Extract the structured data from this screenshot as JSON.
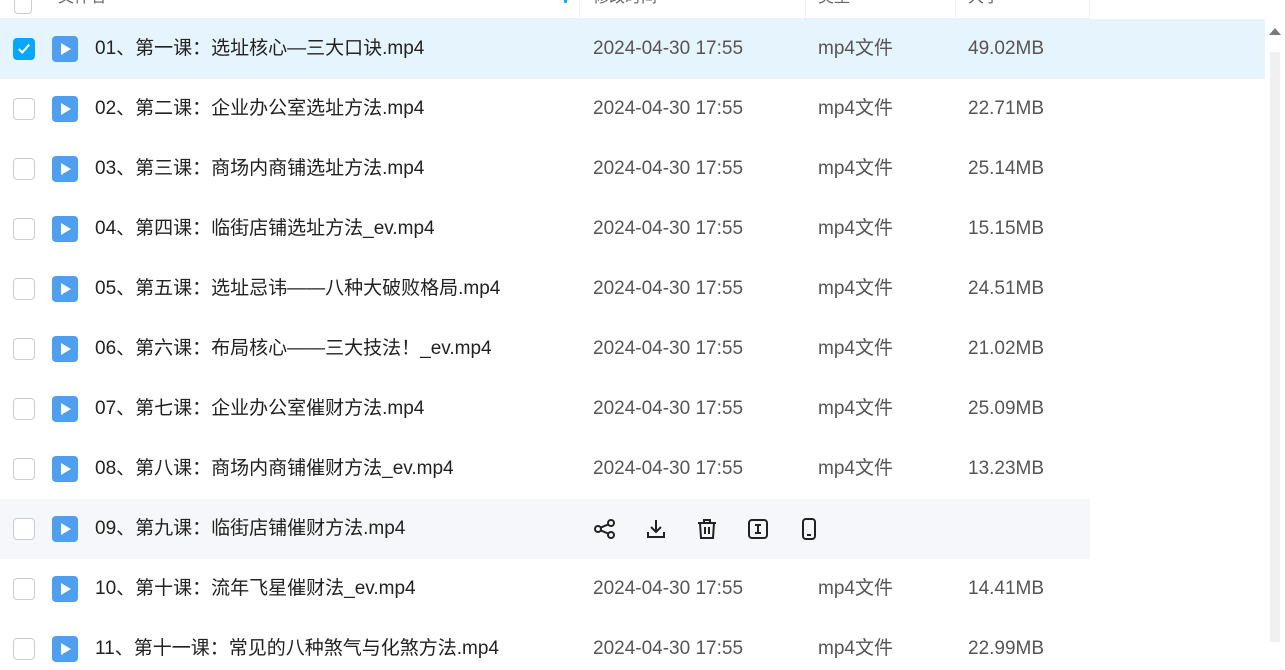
{
  "header": {
    "name_label": "文件名",
    "time_label": "修改时间",
    "type_label": "类型",
    "size_label": "大小"
  },
  "actions": {
    "icons": [
      "share-icon",
      "download-icon",
      "delete-icon",
      "rename-icon",
      "mobile-icon"
    ]
  },
  "colors": {
    "accent": "#06a7ff",
    "selected_row": "#e6f4fd",
    "hover_row": "#f6f7fa",
    "file_icon": "#4e9fef"
  },
  "files": [
    {
      "name": "01、第一课：选址核心—三大口诀.mp4",
      "time": "2024-04-30 17:55",
      "type": "mp4文件",
      "size": "49.02MB"
    },
    {
      "name": "02、第二课：企业办公室选址方法.mp4",
      "time": "2024-04-30 17:55",
      "type": "mp4文件",
      "size": "22.71MB"
    },
    {
      "name": "03、第三课：商场内商铺选址方法.mp4",
      "time": "2024-04-30 17:55",
      "type": "mp4文件",
      "size": "25.14MB"
    },
    {
      "name": "04、第四课：临街店铺选址方法_ev.mp4",
      "time": "2024-04-30 17:55",
      "type": "mp4文件",
      "size": "15.15MB"
    },
    {
      "name": "05、第五课：选址忌讳——八种大破败格局.mp4",
      "time": "2024-04-30 17:55",
      "type": "mp4文件",
      "size": "24.51MB"
    },
    {
      "name": "06、第六课：布局核心——三大技法！_ev.mp4",
      "time": "2024-04-30 17:55",
      "type": "mp4文件",
      "size": "21.02MB"
    },
    {
      "name": "07、第七课：企业办公室催财方法.mp4",
      "time": "2024-04-30 17:55",
      "type": "mp4文件",
      "size": "25.09MB"
    },
    {
      "name": "08、第八课：商场内商铺催财方法_ev.mp4",
      "time": "2024-04-30 17:55",
      "type": "mp4文件",
      "size": "13.23MB"
    },
    {
      "name": "09、第九课：临街店铺催财方法.mp4",
      "time": "",
      "type": "",
      "size": ""
    },
    {
      "name": "10、第十课：流年飞星催财法_ev.mp4",
      "time": "2024-04-30 17:55",
      "type": "mp4文件",
      "size": "14.41MB"
    },
    {
      "name": "11、第十一课：常见的八种煞气与化煞方法.mp4",
      "time": "2024-04-30 17:55",
      "type": "mp4文件",
      "size": "22.99MB"
    }
  ]
}
